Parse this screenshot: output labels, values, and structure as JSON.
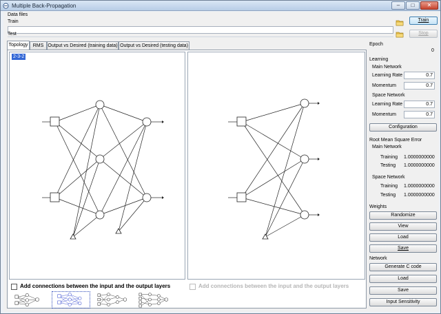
{
  "window": {
    "title": "Multiple Back-Propagation"
  },
  "data_files": {
    "group_label": "Data files",
    "train_label": "Train",
    "test_label": "Test",
    "train_value": "",
    "test_value": "",
    "train_button": "Train",
    "stop_button": "Stop"
  },
  "tabs": [
    {
      "label": "Topology"
    },
    {
      "label": "RMS"
    },
    {
      "label": "Output vs Desired (training data)"
    },
    {
      "label": "Output vs Desired (testing data)"
    }
  ],
  "topology": {
    "value": "2-3-2",
    "main_connections_label": "Add connections between the input and the output layers",
    "space_connections_label": "Add connections between the input and the output layers",
    "main_connections_checked": false,
    "space_connections_checked": false
  },
  "side": {
    "epoch_label": "Epoch",
    "epoch_value": "0",
    "learning_label": "Learning",
    "main_network_label": "Main Network",
    "learning_rate_label": "Learning Rate",
    "momentum_label": "Momentum",
    "main_learning_rate": "0.7",
    "main_momentum": "0.7",
    "space_network_label": "Space Network",
    "space_learning_rate": "0.7",
    "space_momentum": "0.7",
    "configuration_button": "Configuration",
    "rmse_label": "Root Mean Square Error",
    "rmse_main_label": "Main Network",
    "training_label": "Training",
    "testing_label": "Testing",
    "main_training": "1.0000000000",
    "main_testing": "1.0000000000",
    "rmse_space_label": "Space Network",
    "space_training": "1.0000000000",
    "space_testing": "1.0000000000",
    "weights_label": "Weights",
    "randomize_button": "Randomize",
    "view_button": "View",
    "load_button": "Load",
    "save_button": "Save",
    "network_label": "Network",
    "generate_button": "Generate C code",
    "net_load_button": "Load",
    "net_save_button": "Save",
    "sensitivity_button": "Input Sensitivity"
  },
  "colors": {
    "accent": "#3367d6",
    "selected_thumb_net": "#3c4fd0"
  }
}
